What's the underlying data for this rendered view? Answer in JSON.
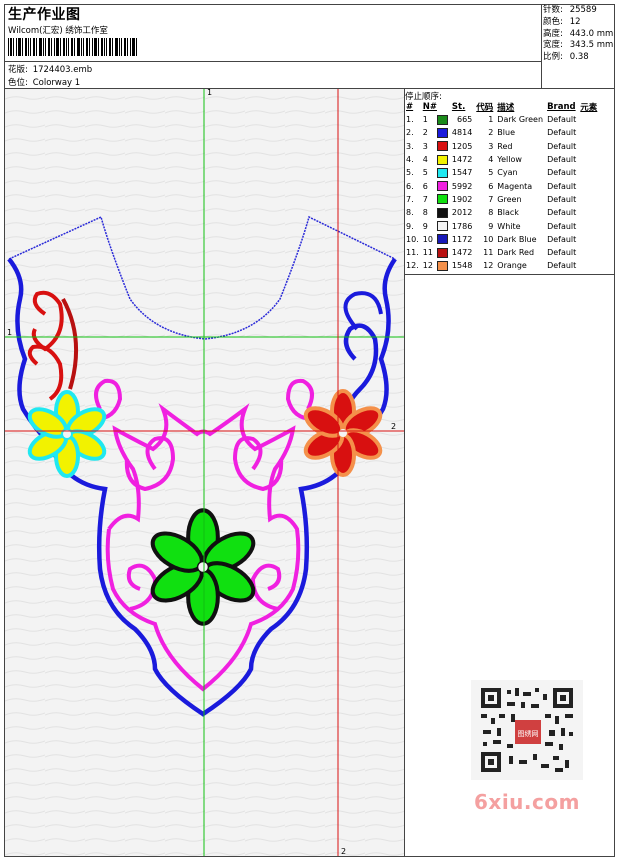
{
  "header": {
    "title": "生产作业图",
    "studio": "Wilcom(汇宏) 绣饰工作室",
    "design_label": "花版:",
    "design_value": "1724403.emb",
    "colorway_label": "色位:",
    "colorway_value": "Colorway 1"
  },
  "stats": {
    "stitches_label": "针数:",
    "stitches_value": "25589",
    "colors_label": "颜色:",
    "colors_value": "12",
    "height_label": "高度:",
    "height_value": "443.0 mm",
    "width_label": "宽度:",
    "width_value": "343.5 mm",
    "scale_label": "比例:",
    "scale_value": "0.38"
  },
  "canvas": {
    "guide_labels": {
      "top": "1",
      "left": "1",
      "right": "2",
      "bottom": "2"
    }
  },
  "stop_sequence_title": "停止顺序:",
  "color_table": {
    "headers": [
      "#",
      "N#",
      "St.",
      "代码",
      "描述",
      "Brand",
      "元素"
    ],
    "rows": [
      {
        "idx": "1.",
        "n": "1",
        "color": "#1a8a1a",
        "st": "665",
        "code": "1",
        "desc": "Dark Green",
        "brand": "Default"
      },
      {
        "idx": "2.",
        "n": "2",
        "color": "#1a1adc",
        "st": "4814",
        "code": "2",
        "desc": "Blue",
        "brand": "Default"
      },
      {
        "idx": "3.",
        "n": "3",
        "color": "#d81010",
        "st": "1205",
        "code": "3",
        "desc": "Red",
        "brand": "Default"
      },
      {
        "idx": "4.",
        "n": "4",
        "color": "#f2f200",
        "st": "1472",
        "code": "4",
        "desc": "Yellow",
        "brand": "Default"
      },
      {
        "idx": "5.",
        "n": "5",
        "color": "#20e8f0",
        "st": "1547",
        "code": "5",
        "desc": "Cyan",
        "brand": "Default"
      },
      {
        "idx": "6.",
        "n": "6",
        "color": "#f020e0",
        "st": "5992",
        "code": "6",
        "desc": "Magenta",
        "brand": "Default"
      },
      {
        "idx": "7.",
        "n": "7",
        "color": "#10e010",
        "st": "1902",
        "code": "7",
        "desc": "Green",
        "brand": "Default"
      },
      {
        "idx": "8.",
        "n": "8",
        "color": "#101010",
        "st": "2012",
        "code": "8",
        "desc": "Black",
        "brand": "Default"
      },
      {
        "idx": "9.",
        "n": "9",
        "color": "#f4f4f4",
        "st": "1786",
        "code": "9",
        "desc": "White",
        "brand": "Default"
      },
      {
        "idx": "10.",
        "n": "10",
        "color": "#1818b8",
        "st": "1172",
        "code": "10",
        "desc": "Dark Blue",
        "brand": "Default"
      },
      {
        "idx": "11.",
        "n": "11",
        "color": "#b81010",
        "st": "1472",
        "code": "11",
        "desc": "Dark Red",
        "brand": "Default"
      },
      {
        "idx": "12.",
        "n": "12",
        "color": "#f4904a",
        "st": "1548",
        "code": "12",
        "desc": "Orange",
        "brand": "Default"
      }
    ]
  },
  "watermark": {
    "text": "6xiu.com",
    "seal_text": "图绣网"
  }
}
